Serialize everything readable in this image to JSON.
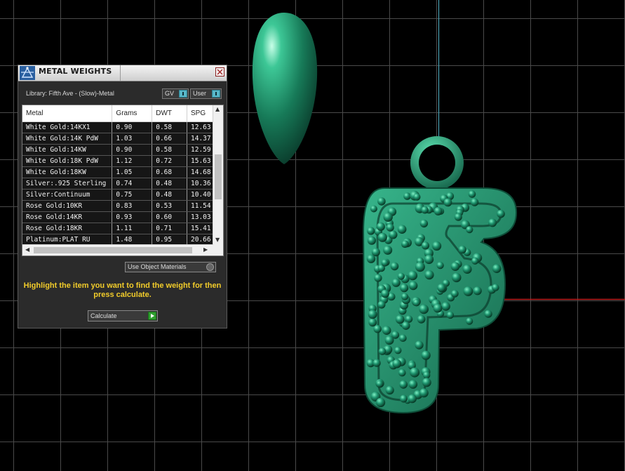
{
  "panel": {
    "title": "METAL WEIGHTS",
    "library_label": "Library: Fifth Ave - (Slow)-Metal",
    "toggle_gv": "GV",
    "toggle_user": "User",
    "columns": [
      "Metal",
      "Grams",
      "DWT",
      "SPG"
    ],
    "rows": [
      [
        "White Gold:14KX1",
        "0.90",
        "0.58",
        "12.63"
      ],
      [
        "White Gold:14K PdW",
        "1.03",
        "0.66",
        "14.37"
      ],
      [
        "White Gold:14KW",
        "0.90",
        "0.58",
        "12.59"
      ],
      [
        "White Gold:18K PdW",
        "1.12",
        "0.72",
        "15.63"
      ],
      [
        "White Gold:18KW",
        "1.05",
        "0.68",
        "14.68"
      ],
      [
        "Silver:.925 Sterling",
        "0.74",
        "0.48",
        "10.36"
      ],
      [
        "Silver:Continuum",
        "0.75",
        "0.48",
        "10.40"
      ],
      [
        "Rose Gold:10KR",
        "0.83",
        "0.53",
        "11.54"
      ],
      [
        "Rose Gold:14KR",
        "0.93",
        "0.60",
        "13.03"
      ],
      [
        "Rose Gold:18KR",
        "1.11",
        "0.71",
        "15.41"
      ],
      [
        "Platinum:PLAT RU",
        "1.48",
        "0.95",
        "20.66"
      ]
    ],
    "use_object_materials": "Use Object Materials",
    "hint": "Highlight the item you want to find the weight for then press calculate.",
    "calculate_label": "Calculate"
  },
  "colors": {
    "viewport_bg": "#000000",
    "grid_line": "#4a4a4a",
    "axis_blue": "#4aa3b5",
    "axis_red": "#c02020",
    "model_green": "#1f8e6a",
    "hint_yellow": "#f2cc2a"
  },
  "icons": {
    "panel_icon": "metal-scale-icon",
    "close": "close-icon"
  }
}
